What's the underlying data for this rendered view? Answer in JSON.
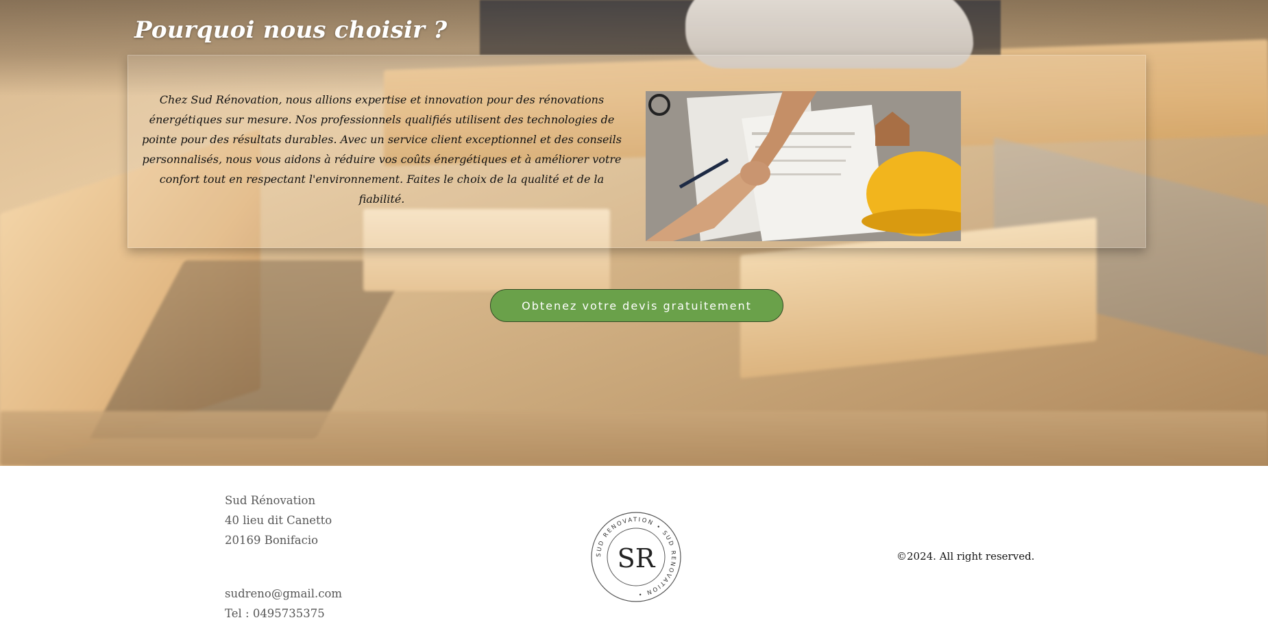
{
  "hero": {
    "title": "Pourquoi nous choisir ?",
    "description": "Chez Sud Rénovation, nous allions expertise et innovation pour des rénovations énergétiques sur mesure. Nos professionnels qualifiés utilisent des technologies de pointe pour des résultats durables. Avec un service client exceptionnel et des conseils personnalisés, nous vous aidons à réduire vos coûts énergétiques et à améliorer votre confort tout en respectant l'environnement. Faites le choix de la qualité et de la fiabilité.",
    "image_icon": "handshake-blueprint-helmet-photo",
    "cta_label": "Obtenez votre devis gratuitement"
  },
  "footer": {
    "company": "Sud Rénovation",
    "street": "40 lieu dit Canetto",
    "city": "20169 Bonifacio",
    "email": "sudreno@gmail.com",
    "phone": "Tel : 0495735375",
    "logo": {
      "monogram": "SR",
      "ring_text": "SUD RENOVATION • SUD RENOVATION •"
    },
    "copyright": "©2024. All right reserved."
  },
  "colors": {
    "cta_background": "#6aa14a",
    "footer_text": "#555555"
  }
}
